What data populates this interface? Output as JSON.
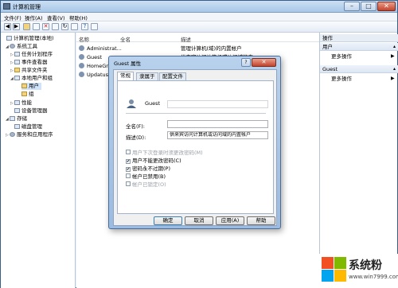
{
  "window": {
    "title": "计算机管理",
    "min": "–",
    "max": "□",
    "close": "✕"
  },
  "menu": [
    "文件(F)",
    "操作(A)",
    "查看(V)",
    "帮助(H)"
  ],
  "tree": [
    {
      "label": "计算机管理(本地)",
      "icon": "computer-icon",
      "level": 0,
      "expander": ""
    },
    {
      "label": "系统工具",
      "icon": "tools-icon",
      "level": 1,
      "expander": "◢"
    },
    {
      "label": "任务计划程序",
      "icon": "clock-icon",
      "level": 2,
      "expander": "▷"
    },
    {
      "label": "事件查看器",
      "icon": "event-icon",
      "level": 2,
      "expander": "▷"
    },
    {
      "label": "共享文件夹",
      "icon": "folder-icon",
      "level": 2,
      "expander": "▷"
    },
    {
      "label": "本地用户和组",
      "icon": "users-icon",
      "level": 2,
      "expander": "◢"
    },
    {
      "label": "用户",
      "icon": "folder-icon",
      "level": 3,
      "expander": "",
      "selected": true
    },
    {
      "label": "组",
      "icon": "folder-icon",
      "level": 3,
      "expander": ""
    },
    {
      "label": "性能",
      "icon": "performance-icon",
      "level": 2,
      "expander": "▷"
    },
    {
      "label": "设备管理器",
      "icon": "device-icon",
      "level": 2,
      "expander": ""
    },
    {
      "label": "存储",
      "icon": "storage-icon",
      "level": 1,
      "expander": "◢"
    },
    {
      "label": "磁盘管理",
      "icon": "disk-icon",
      "level": 2,
      "expander": ""
    },
    {
      "label": "服务和应用程序",
      "icon": "services-icon",
      "level": 1,
      "expander": "▷"
    }
  ],
  "list": {
    "headers": [
      "名称",
      "全名",
      "描述"
    ],
    "rows": [
      {
        "name": "Administrat...",
        "full": "",
        "desc": "管理计算机(域)的内置帐户"
      },
      {
        "name": "Guest",
        "full": "",
        "desc": "供来宾访问计算机或访问域的内..."
      },
      {
        "name": "HomeGro...",
        "full": "",
        "desc": ""
      },
      {
        "name": "UpdatusU...",
        "full": "",
        "desc": ""
      }
    ]
  },
  "actions": {
    "header": "操作",
    "sections": [
      {
        "title": "用户",
        "item": "更多操作"
      },
      {
        "title": "Guest",
        "item": "更多操作"
      }
    ]
  },
  "dialog": {
    "title": "Guest 属性",
    "help": "?",
    "close": "✕",
    "tabs": [
      "常规",
      "隶属于",
      "配置文件"
    ],
    "user_name": "Guest",
    "fullname_label": "全名(F):",
    "fullname_value": "",
    "desc_label": "描述(D):",
    "desc_value": "供来宾访问计算机或访问域的内置帐户",
    "checkboxes": [
      {
        "label": "用户下次登录时须更改密码(M)",
        "checked": false,
        "disabled": true
      },
      {
        "label": "用户不能更改密码(C)",
        "checked": true,
        "disabled": false
      },
      {
        "label": "密码永不过期(P)",
        "checked": true,
        "disabled": false
      },
      {
        "label": "帐户已禁用(B)",
        "checked": false,
        "disabled": false
      },
      {
        "label": "帐户已锁定(O)",
        "checked": false,
        "disabled": true
      }
    ],
    "buttons": [
      "确定",
      "取消",
      "应用(A)",
      "帮助"
    ]
  },
  "watermark": {
    "brand": "系统粉",
    "url": "www.win7999.com"
  }
}
